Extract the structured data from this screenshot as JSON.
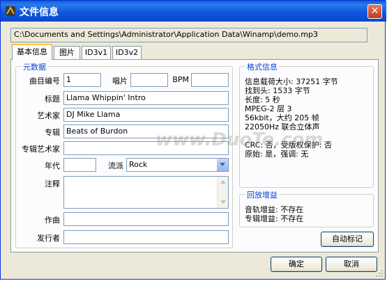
{
  "window": {
    "title": "文件信息"
  },
  "path": "C:\\Documents and Settings\\Administrator\\Application Data\\Winamp\\demo.mp3",
  "tabs": [
    {
      "label": "基本信息"
    },
    {
      "label": "图片"
    },
    {
      "label": "ID3v1"
    },
    {
      "label": "ID3v2"
    }
  ],
  "metadata": {
    "group_title": "元数据",
    "track_label": "曲目编号",
    "track_value": "1",
    "disc_label": "唱片",
    "disc_value": "",
    "bpm_label": "BPM",
    "bpm_value": "",
    "title_label": "标题",
    "title_value": "Llama Whippin' Intro",
    "artist_label": "艺术家",
    "artist_value": "DJ Mike Llama",
    "album_label": "专辑",
    "album_value": "Beats of Burdon",
    "album_artist_label": "专辑艺术家",
    "album_artist_value": "",
    "year_label": "年代",
    "year_value": "",
    "genre_label": "流派",
    "genre_value": "Rock",
    "comment_label": "注释",
    "comment_value": "",
    "composer_label": "作曲",
    "composer_value": "",
    "publisher_label": "发行者",
    "publisher_value": ""
  },
  "format_info": {
    "group_title": "格式信息",
    "lines": [
      "信息载荷大小: 37251 字节",
      "找到头: 1533 字节",
      "长度: 5 秒",
      "MPEG-2 层 3",
      "56kbit，大约 205 帧",
      "22050Hz 联合立体声",
      "",
      "CRC: 否，受版权保护: 否",
      "原始: 是，强调: 无"
    ]
  },
  "replay_gain": {
    "group_title": "回放增益",
    "track_gain": "音轨增益: 不存在",
    "album_gain": "专辑增益: 不存在"
  },
  "buttons": {
    "auto_tag": "自动标记",
    "ok": "确定",
    "cancel": "取消"
  },
  "watermark": {
    "text": "www.DuoTe.com"
  },
  "colors": {
    "titlebar": "#0a5fd6",
    "group_title": "#0046d5",
    "dialog_bg": "#ece9d8",
    "tab_accent": "#ffc83c"
  }
}
